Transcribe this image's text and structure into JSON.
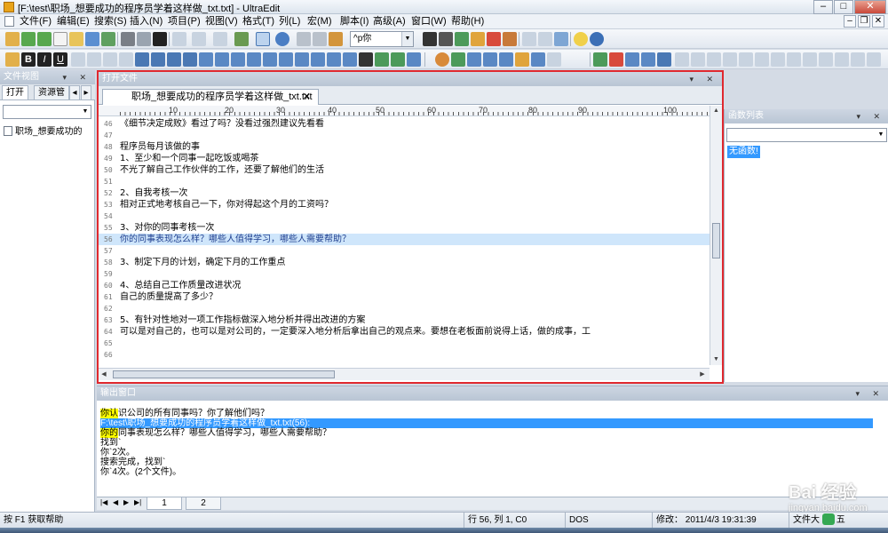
{
  "window": {
    "title": "[F:\\test\\职场_想要成功的程序员学着这样做_txt.txt] - UltraEdit",
    "minimize": "–",
    "maximize": "□",
    "close": "✕"
  },
  "menu": [
    "文件(F)",
    "编辑(E)",
    "搜索(S)",
    "插入(N)",
    "项目(P)",
    "视图(V)",
    "格式(T)",
    "列(L)",
    "宏(M)",
    "脚本(I)",
    "高级(A)",
    "窗口(W)",
    "帮助(H)"
  ],
  "toolbar": {
    "search_value": "^p你"
  },
  "left_panel": {
    "header": "文件视图",
    "tabs": [
      "打开",
      "资源管"
    ],
    "file": "职场_想要成功的"
  },
  "editor": {
    "header": "打开文件",
    "tab_title": "职场_想要成功的程序员学着这样做_txt.txt",
    "ruler": [
      "10",
      "20",
      "30",
      "40",
      "50",
      "60",
      "70",
      "80",
      "90",
      "100"
    ],
    "lines": [
      {
        "n": "46",
        "t": "《细节决定成败》看过了吗？没看过强烈建议先看看"
      },
      {
        "n": "47",
        "t": ""
      },
      {
        "n": "48",
        "t": "程序员每月该做的事"
      },
      {
        "n": "49",
        "t": "1、至少和一个同事一起吃饭或喝茶"
      },
      {
        "n": "50",
        "t": "不光了解自己工作伙伴的工作，还要了解他们的生活"
      },
      {
        "n": "51",
        "t": ""
      },
      {
        "n": "52",
        "t": "2、自我考核一次"
      },
      {
        "n": "53",
        "t": "相对正式地考核自己一下，你对得起这个月的工资吗？"
      },
      {
        "n": "54",
        "t": ""
      },
      {
        "n": "55",
        "t": "3、对你的同事考核一次"
      },
      {
        "n": "56",
        "t": "你的同事表现怎么样？哪些人值得学习，哪些人需要帮助？"
      },
      {
        "n": "57",
        "t": ""
      },
      {
        "n": "58",
        "t": "3、制定下月的计划，确定下月的工作重点"
      },
      {
        "n": "59",
        "t": ""
      },
      {
        "n": "60",
        "t": "4、总结自己工作质量改进状况"
      },
      {
        "n": "61",
        "t": "自己的质量提高了多少？"
      },
      {
        "n": "62",
        "t": ""
      },
      {
        "n": "63",
        "t": "5、有针对性地对一项工作指标做深入地分析并得出改进的方案"
      },
      {
        "n": "64",
        "t": "可以是对自己的，也可以是对公司的，一定要深入地分析后拿出自己的观点来。要想在老板面前说得上话，做的成事，工"
      },
      {
        "n": "65",
        "t": ""
      },
      {
        "n": "66",
        "t": ""
      }
    ]
  },
  "function_list": {
    "header": "函数列表",
    "empty": "无函数!"
  },
  "output": {
    "header": "输出窗口",
    "lines": [
      {
        "mark": "你认",
        "rest": "识公司的所有同事吗？你了解他们吗？"
      },
      {
        "mark": "",
        "rest": "F:\\test\\职场_想要成功的程序员学着这样做_txt.txt(56):"
      },
      {
        "mark": "你的",
        "rest": "同事表现怎么样？哪些人值得学习，哪些人需要帮助？"
      },
      {
        "mark": "",
        "rest": "找到`"
      },
      {
        "mark": "",
        "rest": "你`2次。"
      },
      {
        "mark": "",
        "rest": "搜索完成，找到`"
      },
      {
        "mark": "",
        "rest": "你`4次。(2个文件)。"
      }
    ],
    "tabs": [
      "1",
      "2"
    ]
  },
  "status": {
    "help": "按 F1 获取帮助",
    "position": "行 56, 列 1, C0",
    "format": "DOS",
    "modified": "修改：  2011/4/3 19:31:39",
    "size": "文件大",
    "ime": "五"
  },
  "watermark": {
    "brand": "Bai 经验",
    "url": "jingyan.baidu.com"
  },
  "colors": {
    "highlight_box": "#e0292f",
    "current_line": "#cfe6fb",
    "selection": "#3399ff",
    "search_mark": "#ffff00"
  }
}
